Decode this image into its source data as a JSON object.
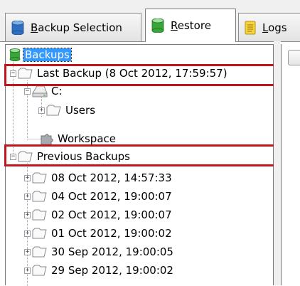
{
  "tabs": [
    {
      "label_pre": "",
      "label_u": "B",
      "label_post": "ackup Selection",
      "icon": "database-icon",
      "active": false
    },
    {
      "label_pre": "",
      "label_u": "R",
      "label_post": "estore",
      "icon": "database-icon",
      "active": true
    },
    {
      "label_pre": "",
      "label_u": "L",
      "label_post": "ogs",
      "icon": "document-icon",
      "active": false
    }
  ],
  "tree": {
    "root": {
      "label": "Backups",
      "icon": "database-icon",
      "selected": true
    },
    "last_backup": {
      "label": "Last Backup (8 Oct 2012, 17:59:57)",
      "icon": "folder-icon",
      "expanded": true
    },
    "drive_c": {
      "label": "C:",
      "icon": "drive-icon"
    },
    "users": {
      "label": "Users",
      "icon": "folder-icon"
    },
    "workspace": {
      "label": "Workspace",
      "icon": "puzzle-icon"
    },
    "previous_backups": {
      "label": "Previous Backups",
      "icon": "folder-icon",
      "expanded": true
    },
    "previous_items": [
      "08 Oct 2012, 14:57:33",
      "04 Oct 2012, 19:00:07",
      "02 Oct 2012, 19:00:07",
      "01 Oct 2012, 19:00:02",
      "30 Sep 2012, 19:00:05",
      "29 Sep 2012, 19:00:02"
    ]
  },
  "colors": {
    "highlight_box": "#c0161b",
    "selection": "#3399ff",
    "database_green": "#3aa53a",
    "database_blue": "#2f6fc0",
    "folder_fill": "#f3f3f3"
  }
}
